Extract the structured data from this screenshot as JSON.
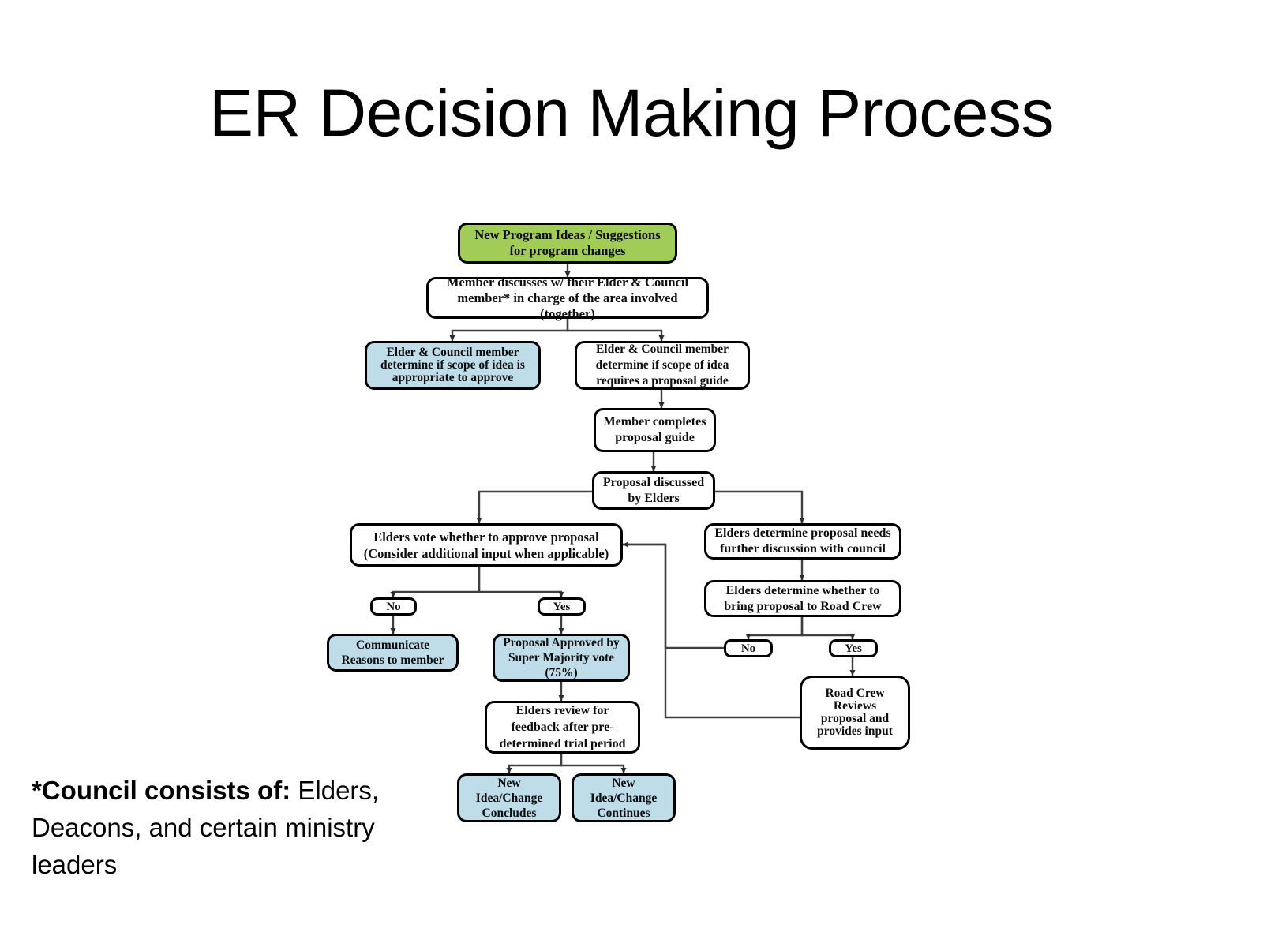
{
  "slide": {
    "title": "ER Decision Making Process",
    "footnote_lead": "*Council consists of:",
    "footnote_rest": " Elders, Deacons, and certain ministry leaders"
  },
  "colors": {
    "start_fill": "#A2CC58",
    "terminal_fill": "#BFDCE9",
    "default_fill": "#FFFFFF",
    "border": "#000000",
    "connector": "#3F3F3F",
    "text": "#0D0D0D",
    "background": "#FFFFFF"
  },
  "flowchart": {
    "type": "process-flow-diagram",
    "nodes": [
      {
        "id": "start",
        "label": "New Program Ideas / Suggestions\nfor program changes",
        "fill": "start_fill",
        "shape": "rounded-rectangle"
      },
      {
        "id": "member_discusses",
        "label": "Member discusses w/ their Elder & Council\nmember* in charge of the area involved (together)",
        "fill": "default_fill",
        "shape": "rounded-rectangle"
      },
      {
        "id": "scope_approve",
        "label": "Elder & Council member\ndetermine if scope of idea is\nappropriate to approve",
        "fill": "terminal_fill",
        "shape": "rounded-rectangle"
      },
      {
        "id": "scope_guide",
        "label": "Elder & Council member\ndetermine if scope of idea\nrequires a proposal guide",
        "fill": "default_fill",
        "shape": "rounded-rectangle"
      },
      {
        "id": "member_completes",
        "label": "Member completes\nproposal guide",
        "fill": "default_fill",
        "shape": "rounded-rectangle"
      },
      {
        "id": "proposal_discussed",
        "label": "Proposal discussed\nby Elders",
        "fill": "default_fill",
        "shape": "rounded-rectangle"
      },
      {
        "id": "elders_vote",
        "label": "Elders vote whether  to approve  proposal\n(Consider additional input when applicable)",
        "fill": "default_fill",
        "shape": "rounded-rectangle"
      },
      {
        "id": "vote_no",
        "label": "No",
        "fill": "default_fill",
        "shape": "rounded-rectangle"
      },
      {
        "id": "vote_yes",
        "label": "Yes",
        "fill": "default_fill",
        "shape": "rounded-rectangle"
      },
      {
        "id": "communicate_reasons",
        "label": "Communicate\nReasons  to member",
        "fill": "terminal_fill",
        "shape": "rounded-rectangle"
      },
      {
        "id": "proposal_approved",
        "label": "Proposal Approved by\nSuper Majority vote\n(75%)",
        "fill": "terminal_fill",
        "shape": "rounded-rectangle"
      },
      {
        "id": "elders_review",
        "label": "Elders review for\nfeedback after pre-\ndetermined trial period",
        "fill": "default_fill",
        "shape": "rounded-rectangle"
      },
      {
        "id": "change_concludes",
        "label": "New\nIdea/Change\nConcludes",
        "fill": "terminal_fill",
        "shape": "rounded-rectangle"
      },
      {
        "id": "change_continues",
        "label": "New\nIdea/Change\nContinues",
        "fill": "terminal_fill",
        "shape": "rounded-rectangle"
      },
      {
        "id": "further_discussion",
        "label": "Elders determine proposal needs\nfurther discussion with council",
        "fill": "default_fill",
        "shape": "rounded-rectangle"
      },
      {
        "id": "bring_road_crew",
        "label": "Elders determine whether to\nbring proposal to Road Crew",
        "fill": "default_fill",
        "shape": "rounded-rectangle"
      },
      {
        "id": "crew_no",
        "label": "No",
        "fill": "default_fill",
        "shape": "rounded-rectangle"
      },
      {
        "id": "crew_yes",
        "label": "Yes",
        "fill": "default_fill",
        "shape": "rounded-rectangle"
      },
      {
        "id": "road_crew_reviews",
        "label": "Road Crew\nReviews\nproposal and\nprovides input",
        "fill": "default_fill",
        "shape": "rounded-rectangle"
      }
    ],
    "edges": [
      {
        "from": "start",
        "to": "member_discusses"
      },
      {
        "from": "member_discusses",
        "to": "scope_approve"
      },
      {
        "from": "member_discusses",
        "to": "scope_guide"
      },
      {
        "from": "scope_guide",
        "to": "member_completes"
      },
      {
        "from": "member_completes",
        "to": "proposal_discussed"
      },
      {
        "from": "proposal_discussed",
        "to": "elders_vote"
      },
      {
        "from": "proposal_discussed",
        "to": "further_discussion"
      },
      {
        "from": "elders_vote",
        "to": "vote_no"
      },
      {
        "from": "elders_vote",
        "to": "vote_yes"
      },
      {
        "from": "vote_no",
        "to": "communicate_reasons"
      },
      {
        "from": "vote_yes",
        "to": "proposal_approved"
      },
      {
        "from": "proposal_approved",
        "to": "elders_review"
      },
      {
        "from": "elders_review",
        "to": "change_concludes"
      },
      {
        "from": "elders_review",
        "to": "change_continues"
      },
      {
        "from": "further_discussion",
        "to": "bring_road_crew"
      },
      {
        "from": "bring_road_crew",
        "to": "crew_no"
      },
      {
        "from": "bring_road_crew",
        "to": "crew_yes"
      },
      {
        "from": "crew_yes",
        "to": "road_crew_reviews"
      },
      {
        "from": "crew_no",
        "to": "elders_vote"
      },
      {
        "from": "road_crew_reviews",
        "to": "elders_vote"
      }
    ]
  }
}
